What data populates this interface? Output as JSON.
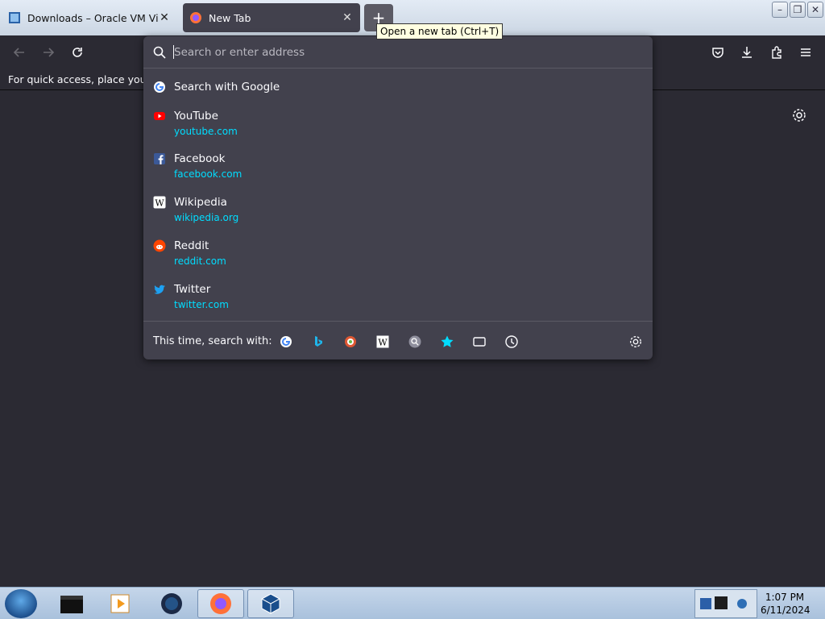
{
  "tabs": [
    {
      "title": "Downloads – Oracle VM VirtualBox",
      "active": false
    },
    {
      "title": "New Tab",
      "active": true
    }
  ],
  "new_tab_tooltip": "Open a new tab (Ctrl+T)",
  "bookmarks_toolbar_text": "For quick access, place your boo",
  "urlbar": {
    "placeholder": "Search or enter address",
    "search_suggestion": "Search with Google",
    "results": [
      {
        "title": "YouTube",
        "url": "youtube.com",
        "icon": "youtube-icon",
        "color": "#ff0000"
      },
      {
        "title": "Facebook",
        "url": "facebook.com",
        "icon": "facebook-icon",
        "color": "#3b5998"
      },
      {
        "title": "Wikipedia",
        "url": "wikipedia.org",
        "icon": "wikipedia-icon",
        "color": "#ffffff"
      },
      {
        "title": "Reddit",
        "url": "reddit.com",
        "icon": "reddit-icon",
        "color": "#ff4500"
      },
      {
        "title": "Twitter",
        "url": "twitter.com",
        "icon": "twitter-icon",
        "color": "#1da1f2"
      }
    ],
    "one_off_label": "This time, search with:",
    "one_off_engines": [
      "google-icon",
      "bing-icon",
      "duckduckgo-icon",
      "wikipedia-icon",
      "search-engine-icon",
      "bookmarks-star-icon",
      "tabs-icon",
      "history-clock-icon"
    ]
  },
  "clock": {
    "time": "1:07 PM",
    "date": "6/11/2024"
  },
  "colors": {
    "accent_url": "#00ddff",
    "panel_bg": "#42414d",
    "page_bg": "#2b2a33"
  }
}
